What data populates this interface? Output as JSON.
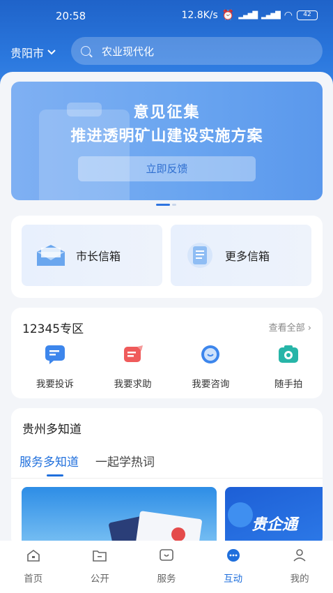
{
  "status": {
    "time": "20:58",
    "network": "12.8K/s",
    "battery": "42"
  },
  "header": {
    "city": "贵阳市",
    "search_text": "农业现代化"
  },
  "banner": {
    "title": "意见征集",
    "subtitle": "推进透明矿山建设实施方案",
    "button": "立即反馈"
  },
  "mailboxes": [
    {
      "label": "市长信箱"
    },
    {
      "label": "更多信箱"
    }
  ],
  "zone": {
    "title": "12345专区",
    "more": "查看全部",
    "items": [
      {
        "label": "我要投诉",
        "icon": "complaint-icon"
      },
      {
        "label": "我要求助",
        "icon": "help-icon"
      },
      {
        "label": "我要咨询",
        "icon": "consult-icon"
      },
      {
        "label": "随手拍",
        "icon": "camera-icon"
      }
    ]
  },
  "knowledge": {
    "title": "贵州多知道",
    "tabs": [
      {
        "label": "服务多知道",
        "active": true
      },
      {
        "label": "一起学热词",
        "active": false
      }
    ],
    "card2_text": "贵企通"
  },
  "nav": [
    {
      "label": "首页",
      "icon": "home-icon",
      "active": false
    },
    {
      "label": "公开",
      "icon": "folder-icon",
      "active": false
    },
    {
      "label": "服务",
      "icon": "service-icon",
      "active": false
    },
    {
      "label": "互动",
      "icon": "chat-icon",
      "active": true
    },
    {
      "label": "我的",
      "icon": "user-icon",
      "active": false
    }
  ],
  "colors": {
    "primary": "#1f6fdc",
    "header_bg": "#2b78de"
  }
}
